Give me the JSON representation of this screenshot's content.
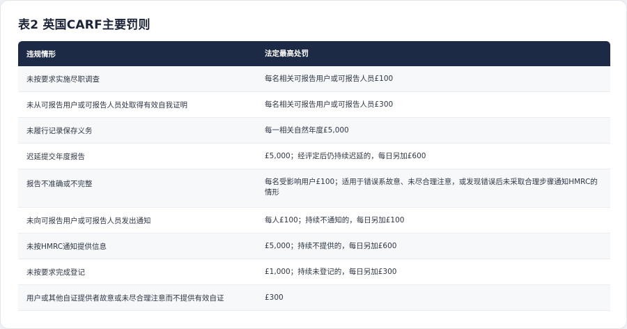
{
  "title": "表2 英国CARF主要罚则",
  "table": {
    "headers": [
      "违规情形",
      "法定最高处罚"
    ],
    "rows": [
      [
        "未按要求实施尽职调查",
        "每名相关可报告用户或可报告人员£100"
      ],
      [
        "未从可报告用户或可报告人员处取得有效自我证明",
        "每名相关可报告用户或可报告人员£300"
      ],
      [
        "未履行记录保存义务",
        "每一相关自然年度£5,000"
      ],
      [
        "迟延提交年度报告",
        "£5,000；经评定后仍持续迟延的，每日另加£600"
      ],
      [
        "报告不准确或不完整",
        "每名受影响用户£100；适用于错误系故意、未尽合理注意，或发现错误后未采取合理步骤通知HMRC的情形"
      ],
      [
        "未向可报告用户或可报告人员发出通知",
        "每人£100；持续不通知的，每日另加£100"
      ],
      [
        "未按HMRC通知提供信息",
        "£5,000；持续不提供的，每日另加£600"
      ],
      [
        "未按要求完成登记",
        "£1,000；持续未登记的，每日另加£300"
      ],
      [
        "用户或其他自证提供者故意或未尽合理注意而不提供有效自证",
        "£300"
      ]
    ]
  }
}
